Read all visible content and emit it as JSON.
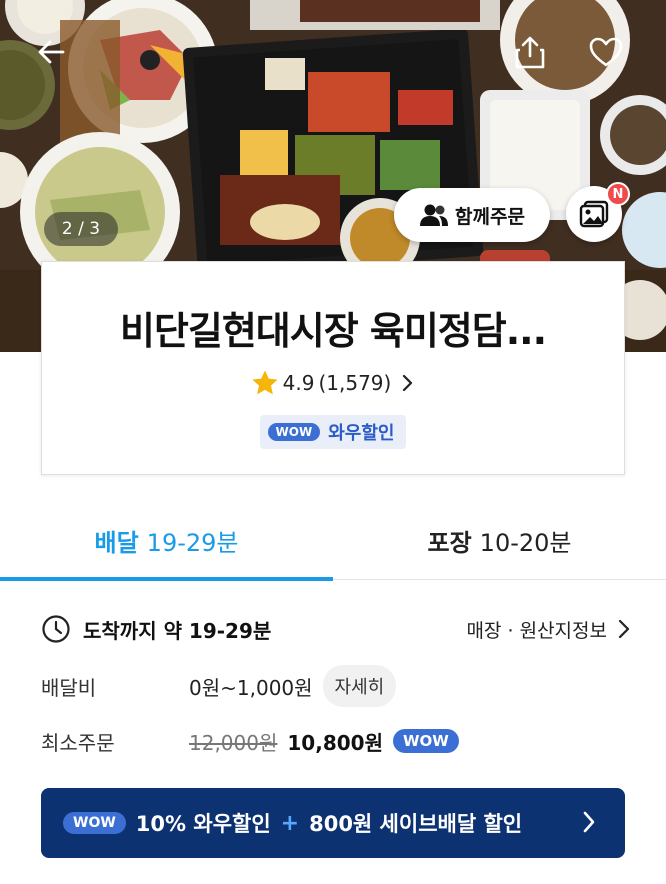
{
  "hero": {
    "page_indicator": "2 / 3",
    "group_order_label": "함께주문",
    "new_badge": "N"
  },
  "store": {
    "name": "비단길현대시장 육미정담...",
    "rating": "4.9",
    "review_count": "(1,579)",
    "wow_label": "와우할인",
    "wow_pill": "WOW"
  },
  "tabs": [
    {
      "label": "배달",
      "time": "19-29분",
      "active": true
    },
    {
      "label": "포장",
      "time": "10-20분",
      "active": false
    }
  ],
  "delivery": {
    "eta_label": "도착까지 약 19-29분",
    "origin_link": "매장 · 원산지정보",
    "fee_label": "배달비",
    "fee_value": "0원~1,000원",
    "fee_detail": "자세히",
    "min_label": "최소주문",
    "min_original": "12,000원",
    "min_discounted": "10,800원",
    "min_wow_pill": "WOW"
  },
  "promo": {
    "pill": "WOW",
    "part1": "10% 와우할인",
    "plus": "+",
    "part2": "800원 세이브배달 할인"
  },
  "colors": {
    "accent_blue": "#1a9bea",
    "wow_blue": "#3b6fd4",
    "promo_navy": "#0d3272",
    "star": "#f5b50a",
    "badge_red": "#f04b4b"
  }
}
